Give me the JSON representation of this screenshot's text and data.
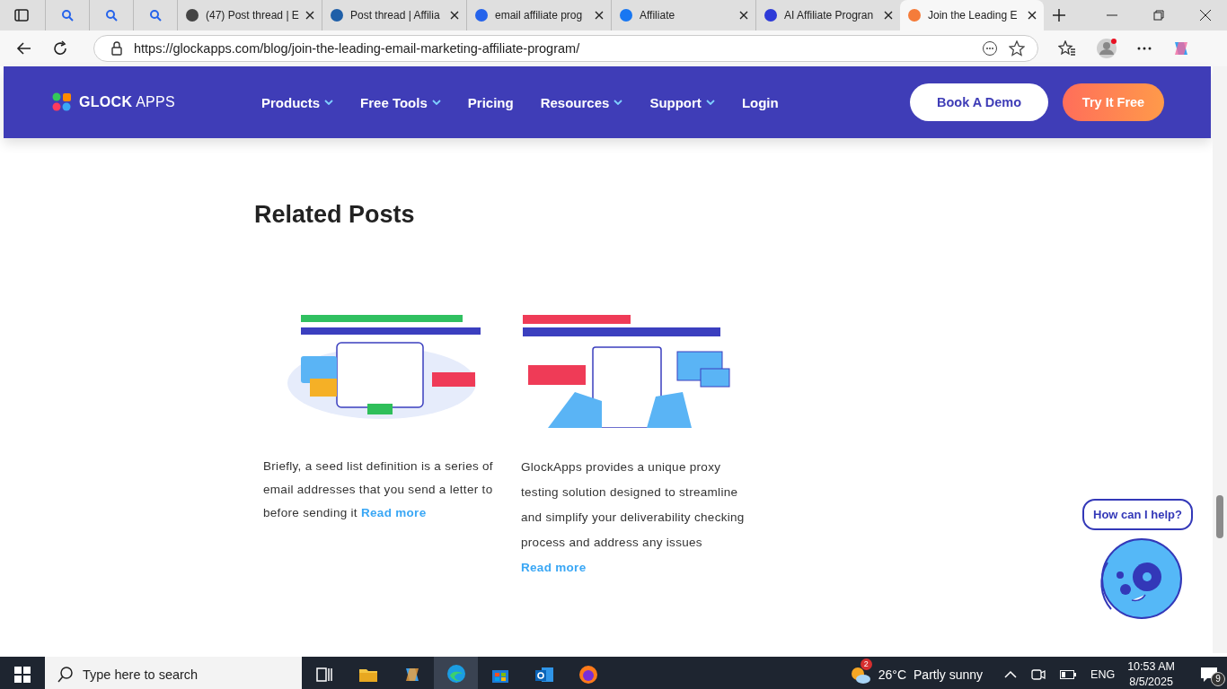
{
  "browser": {
    "tabs": [
      {
        "selected": false
      },
      {
        "selected": false
      },
      {
        "selected": false
      },
      {
        "title": "(47) Post thread | E",
        "selected": false
      },
      {
        "title": "Post thread | Affilia",
        "selected": false
      },
      {
        "title": "email affiliate prog",
        "selected": false
      },
      {
        "title": "Affiliate",
        "selected": false
      },
      {
        "title": "AI Affiliate Progran",
        "selected": false
      },
      {
        "title": "Join the Leading E",
        "selected": true
      }
    ],
    "url": "https://glockapps.com/blog/join-the-leading-email-marketing-affiliate-program/"
  },
  "header": {
    "logo_bold": "GLOCK",
    "logo_light": "APPS",
    "nav": [
      {
        "label": "Products",
        "dropdown": true
      },
      {
        "label": "Free Tools",
        "dropdown": true
      },
      {
        "label": "Pricing",
        "dropdown": false
      },
      {
        "label": "Resources",
        "dropdown": true
      },
      {
        "label": "Support",
        "dropdown": true
      },
      {
        "label": "Login",
        "dropdown": false
      }
    ],
    "buttons": [
      {
        "label": "Book A Demo",
        "kind": "outline"
      },
      {
        "label": "Try It Free",
        "kind": "gradient"
      }
    ]
  },
  "related": {
    "heading": "Related Posts",
    "posts": [
      {
        "excerpt": "Briefly, a seed list definition is a series of email addresses that you send a letter to before sending it",
        "link": "Read more"
      },
      {
        "excerpt": "GlockApps provides a unique proxy testing solution designed to streamline and simplify your deliverability checking process and address any issues",
        "link": "Read more"
      }
    ]
  },
  "chat": {
    "bubble": "How can I help?"
  },
  "taskbar": {
    "search_placeholder": "Type here to search",
    "weather_badge": "2",
    "temperature": "26°C",
    "weather": "Partly sunny",
    "language": "ENG",
    "time": "10:53 AM",
    "date": "8/5/2025",
    "notifications": "9"
  }
}
